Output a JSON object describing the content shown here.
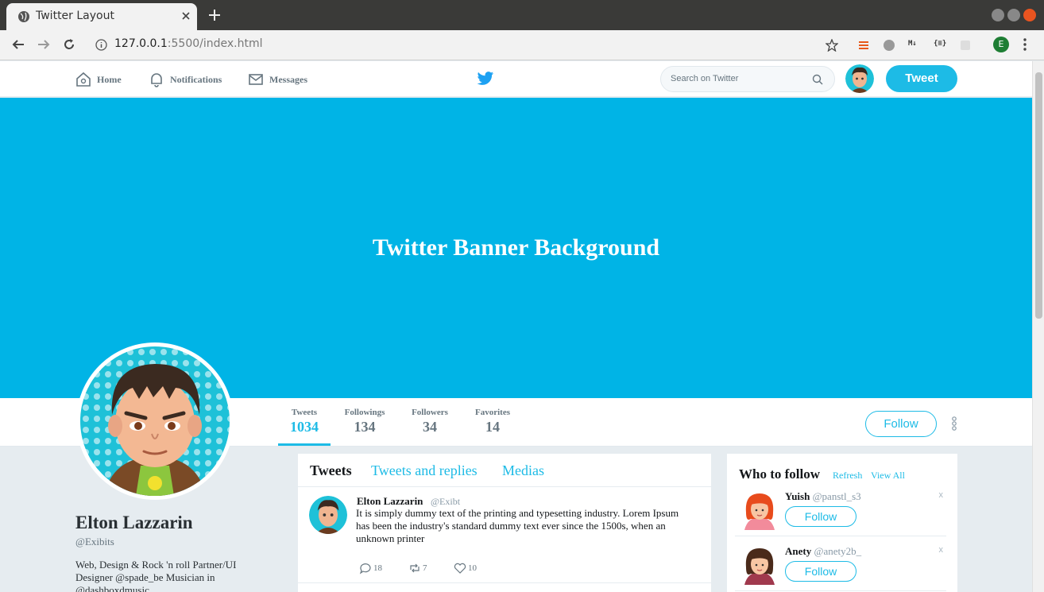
{
  "browser": {
    "tab_title": "Twitter Layout",
    "url_host": "127.0.0.1",
    "url_path": ":5500/index.html",
    "profile_initial": "E",
    "ext_md": "M↓",
    "ext_json": "{≡}"
  },
  "nav": {
    "home": "Home",
    "notifications": "Notifications",
    "messages": "Messages",
    "search_placeholder": "Search on Twitter",
    "tweet": "Tweet"
  },
  "banner": {
    "title": "Twitter Banner Background"
  },
  "stats": {
    "tweets_label": "Tweets",
    "tweets_value": "1034",
    "followings_label": "Followings",
    "followings_value": "134",
    "followers_label": "Followers",
    "followers_value": "34",
    "favorites_label": "Favorites",
    "favorites_value": "14",
    "follow": "Follow"
  },
  "profile": {
    "name": "Elton Lazzarin",
    "handle": "@Exibits",
    "bio": "Web, Design & Rock 'n roll Partner/UI Designer @spade_be Musician in @dashboxdmusic"
  },
  "feed": {
    "tabs": [
      "Tweets",
      "Tweets and replies",
      "Medias"
    ],
    "tweet": {
      "name": "Elton Lazzarin",
      "handle": "@Exibt",
      "body": "It is simply dummy text of the printing and typesetting industry. Lorem Ipsum has been the industry's standard dummy text ever since the 1500s, when an unknown printer",
      "replies": "18",
      "retweets": "7",
      "likes": "10"
    }
  },
  "who_to_follow": {
    "title": "Who to follow",
    "refresh": "Refresh",
    "view_all": "View All",
    "users": [
      {
        "name": "Yuish",
        "handle": "@panstl_s3",
        "follow": "Follow",
        "dismiss": "x"
      },
      {
        "name": "Anety",
        "handle": "@anety2b_",
        "follow": "Follow",
        "dismiss": "x"
      }
    ]
  },
  "colors": {
    "accent": "#1dbbe6",
    "banner": "#00b4e6",
    "page_bg": "#e6ecf0"
  }
}
